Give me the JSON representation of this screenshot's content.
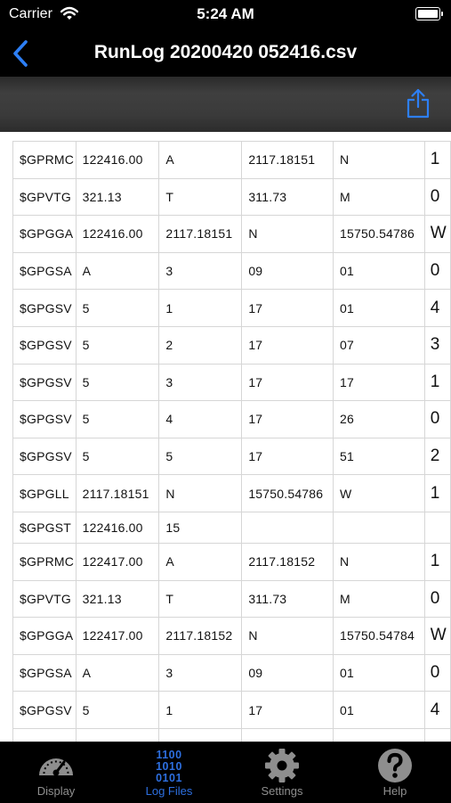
{
  "status": {
    "carrier": "Carrier",
    "time": "5:24 AM"
  },
  "nav": {
    "title": "RunLog 20200420 052416.csv"
  },
  "table": {
    "rows": [
      [
        "$GPRMC",
        "122416.00",
        "A",
        "2117.18151",
        "N",
        "1"
      ],
      [
        "$GPVTG",
        "321.13",
        "T",
        "311.73",
        "M",
        "0"
      ],
      [
        "$GPGGA",
        "122416.00",
        "2117.18151",
        "N",
        "15750.54786",
        "W"
      ],
      [
        "$GPGSA",
        "A",
        "3",
        "09",
        "01",
        "0"
      ],
      [
        "$GPGSV",
        "5",
        "1",
        "17",
        "01",
        "4"
      ],
      [
        "$GPGSV",
        "5",
        "2",
        "17",
        "07",
        "3"
      ],
      [
        "$GPGSV",
        "5",
        "3",
        "17",
        "17",
        "1"
      ],
      [
        "$GPGSV",
        "5",
        "4",
        "17",
        "26",
        "0"
      ],
      [
        "$GPGSV",
        "5",
        "5",
        "17",
        "51",
        "2"
      ],
      [
        "$GPGLL",
        "2117.18151",
        "N",
        "15750.54786",
        "W",
        "1"
      ],
      [
        "$GPGST",
        "122416.00",
        "15",
        "",
        "",
        ""
      ],
      [
        "$GPRMC",
        "122417.00",
        "A",
        "2117.18152",
        "N",
        "1"
      ],
      [
        "$GPVTG",
        "321.13",
        "T",
        "311.73",
        "M",
        "0"
      ],
      [
        "$GPGGA",
        "122417.00",
        "2117.18152",
        "N",
        "15750.54784",
        "W"
      ],
      [
        "$GPGSA",
        "A",
        "3",
        "09",
        "01",
        "0"
      ],
      [
        "$GPGSV",
        "5",
        "1",
        "17",
        "01",
        "4"
      ],
      [
        "",
        "",
        "",
        "",
        "",
        ""
      ]
    ]
  },
  "tabs": [
    {
      "label": "Display",
      "icon": "gauge-icon",
      "active": false
    },
    {
      "label": "Log Files",
      "icon": "binary-icon",
      "active": true,
      "icon_lines": [
        "1100",
        "1010",
        "0101"
      ]
    },
    {
      "label": "Settings",
      "icon": "gear-icon",
      "active": false
    },
    {
      "label": "Help",
      "icon": "help-icon",
      "active": false
    }
  ],
  "colors": {
    "accent": "#2d6fe0",
    "inactive": "#8e8e8e"
  }
}
